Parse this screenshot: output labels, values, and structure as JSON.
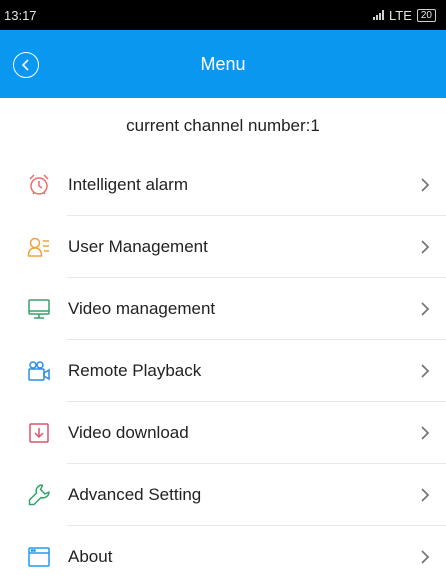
{
  "status_bar": {
    "time": "13:17",
    "network": "LTE",
    "battery": "20"
  },
  "header": {
    "title": "Menu"
  },
  "channel_text": "current channel number:1",
  "menu": {
    "items": [
      {
        "label": "Intelligent alarm",
        "icon": "alarm-clock-icon",
        "color": "#f06a6a"
      },
      {
        "label": "User Management",
        "icon": "user-list-icon",
        "color": "#f0a23a"
      },
      {
        "label": "Video management",
        "icon": "monitor-icon",
        "color": "#3aa06a"
      },
      {
        "label": "Remote Playback",
        "icon": "video-camera-icon",
        "color": "#2a8de6"
      },
      {
        "label": "Video download",
        "icon": "download-icon",
        "color": "#d9536a"
      },
      {
        "label": "Advanced Setting",
        "icon": "wrench-icon",
        "color": "#2fa46a"
      },
      {
        "label": "About",
        "icon": "window-icon",
        "color": "#1f9be8"
      }
    ]
  },
  "colors": {
    "header": "#0a97f0",
    "status_bar": "#000000"
  }
}
